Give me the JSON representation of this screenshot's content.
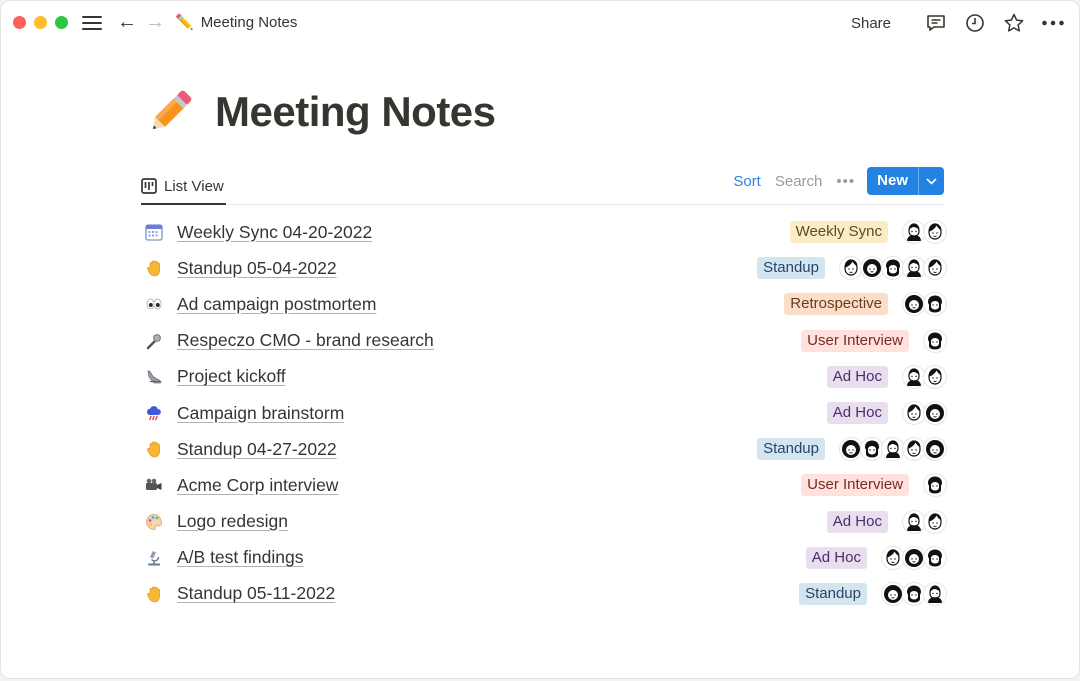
{
  "window": {
    "breadcrumb": {
      "emoji": "✏️",
      "label": "Meeting Notes"
    },
    "share_label": "Share",
    "icons": [
      "hamburger-icon",
      "back-arrow-icon",
      "forward-arrow-icon",
      "comment-icon",
      "clock-icon",
      "star-icon",
      "more-icon"
    ]
  },
  "page": {
    "title": "Meeting Notes",
    "title_icon": "pencil-icon"
  },
  "view": {
    "tab_label": "List View",
    "sort_label": "Sort",
    "search_label": "Search",
    "more_label": "•••",
    "new_label": "New"
  },
  "tag_colors": {
    "Weekly Sync": {
      "bg": "#fbecc7",
      "fg": "#5e4a1b"
    },
    "Standup": {
      "bg": "#d3e5ef",
      "fg": "#28456c"
    },
    "Retrospective": {
      "bg": "#fadec9",
      "fg": "#6a3a1b"
    },
    "User Interview": {
      "bg": "#ffe2dd",
      "fg": "#7c2a22"
    },
    "Ad Hoc": {
      "bg": "#e8deee",
      "fg": "#4b2d6b"
    }
  },
  "rows": [
    {
      "icon": "calendar-icon",
      "title": "Weekly Sync 04-20-2022",
      "tag": "Weekly Sync",
      "avatars": 2
    },
    {
      "icon": "raised-hand-icon",
      "title": "Standup 05-04-2022",
      "tag": "Standup",
      "avatars": 5
    },
    {
      "icon": "eyes-icon",
      "title": "Ad campaign postmortem",
      "tag": "Retrospective",
      "avatars": 2
    },
    {
      "icon": "microphone-icon",
      "title": "Respeczo CMO - brand research",
      "tag": "User Interview",
      "avatars": 1
    },
    {
      "icon": "shoe-icon",
      "title": "Project kickoff",
      "tag": "Ad Hoc",
      "avatars": 2
    },
    {
      "icon": "storm-cloud-icon",
      "title": "Campaign brainstorm",
      "tag": "Ad Hoc",
      "avatars": 2
    },
    {
      "icon": "raised-hand-icon",
      "title": "Standup 04-27-2022",
      "tag": "Standup",
      "avatars": 5
    },
    {
      "icon": "video-camera-icon",
      "title": "Acme Corp interview",
      "tag": "User Interview",
      "avatars": 1
    },
    {
      "icon": "palette-icon",
      "title": "Logo redesign",
      "tag": "Ad Hoc",
      "avatars": 2
    },
    {
      "icon": "microscope-icon",
      "title": "A/B test findings",
      "tag": "Ad Hoc",
      "avatars": 3
    },
    {
      "icon": "raised-hand-icon",
      "title": "Standup 05-11-2022",
      "tag": "Standup",
      "avatars": 3
    }
  ]
}
